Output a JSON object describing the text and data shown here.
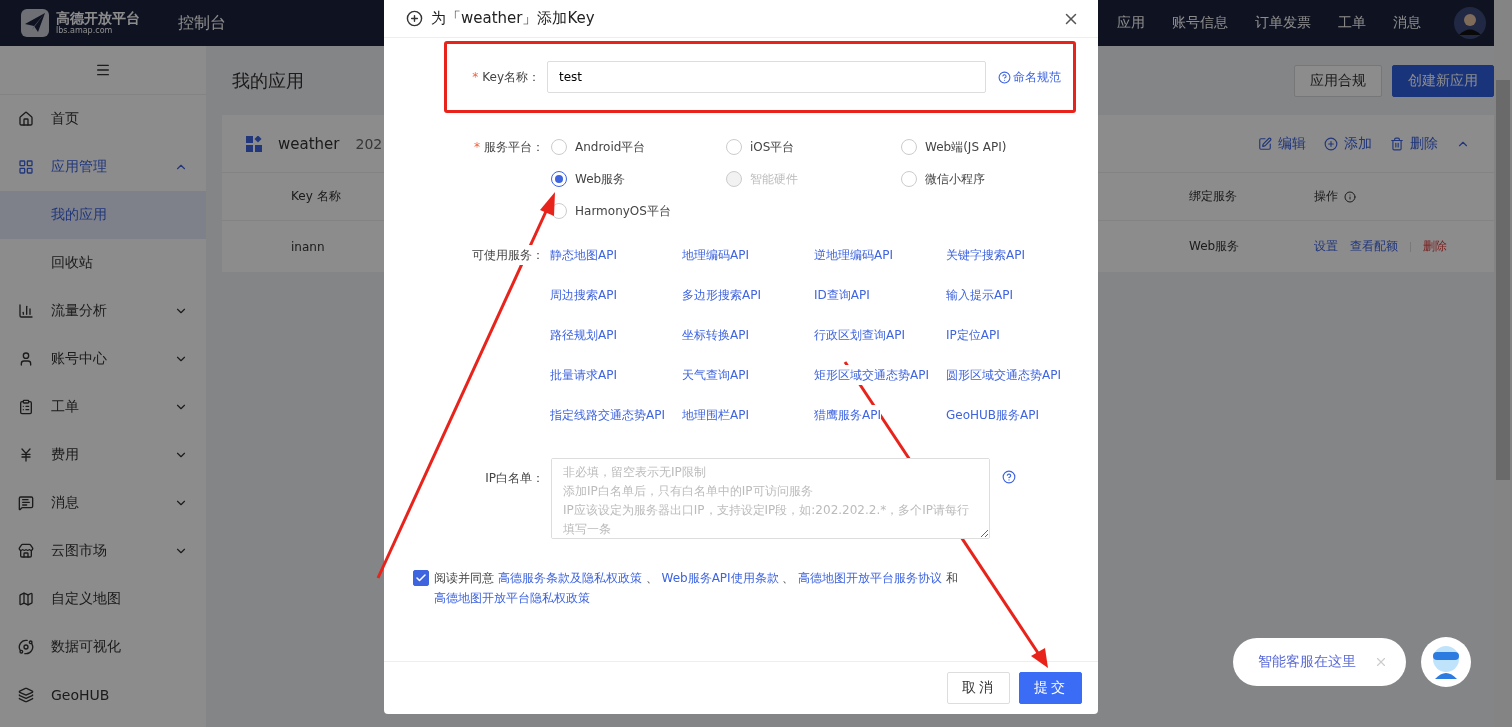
{
  "topbar": {
    "logo_name": "高德开放平台",
    "logo_url": "lbs.amap.com",
    "console": "控制台",
    "nav": [
      "应用",
      "账号信息",
      "订单发票",
      "工单",
      "消息"
    ]
  },
  "sidebar": {
    "items": [
      {
        "label": "首页",
        "kind": "link",
        "selected": false
      },
      {
        "label": "应用管理",
        "kind": "group",
        "selected": true,
        "expanded": true,
        "children": [
          {
            "label": "我的应用",
            "selected": true
          },
          {
            "label": "回收站",
            "selected": false
          }
        ]
      },
      {
        "label": "流量分析",
        "kind": "group",
        "selected": false,
        "expanded": false
      },
      {
        "label": "账号中心",
        "kind": "group",
        "selected": false,
        "expanded": false
      },
      {
        "label": "工单",
        "kind": "group",
        "selected": false,
        "expanded": false
      },
      {
        "label": "费用",
        "kind": "group",
        "selected": false,
        "expanded": false
      },
      {
        "label": "消息",
        "kind": "group",
        "selected": false,
        "expanded": false
      },
      {
        "label": "云图市场",
        "kind": "group",
        "selected": false,
        "expanded": false
      },
      {
        "label": "自定义地图",
        "kind": "link",
        "selected": false
      },
      {
        "label": "数据可视化",
        "kind": "link",
        "selected": false
      },
      {
        "label": "GeoHUB",
        "kind": "link",
        "selected": false
      }
    ]
  },
  "main": {
    "title": "我的应用",
    "buttons": [
      {
        "label": "应用合规",
        "kind": "default"
      },
      {
        "label": "创建新应用",
        "kind": "primary"
      }
    ]
  },
  "app_card": {
    "name": "weather",
    "date": "202",
    "expanded": true,
    "actions": [
      "编辑",
      "添加",
      "删除"
    ],
    "columns": [
      "Key 名称",
      "绑定服务",
      "操作"
    ],
    "rows": [
      {
        "key_name": "inann",
        "service": "Web服务",
        "actions": [
          {
            "label": "设置",
            "kind": "link"
          },
          {
            "label": "查看配额",
            "kind": "link"
          },
          {
            "label": "删除",
            "kind": "danger"
          }
        ]
      }
    ]
  },
  "dialog": {
    "title": "为「weather」添加Key",
    "key_name": {
      "mark": "*",
      "label": "Key名称：",
      "value": "test",
      "help": "命名规范",
      "highlighted": true
    },
    "platform": {
      "mark": "*",
      "label": "服务平台：",
      "options": [
        {
          "label": "Android平台",
          "selected": false,
          "disabled": false
        },
        {
          "label": "iOS平台",
          "selected": false,
          "disabled": false
        },
        {
          "label": "Web端(JS API)",
          "selected": false,
          "disabled": false
        },
        {
          "label": "Web服务",
          "selected": true,
          "disabled": false
        },
        {
          "label": "智能硬件",
          "selected": false,
          "disabled": true
        },
        {
          "label": "微信小程序",
          "selected": false,
          "disabled": false
        },
        {
          "label": "HarmonyOS平台",
          "selected": false,
          "disabled": false
        }
      ]
    },
    "services": {
      "label": "可使用服务：",
      "items": [
        "静态地图API",
        "地理编码API",
        "逆地理编码API",
        "关键字搜索API",
        "周边搜索API",
        "多边形搜索API",
        "ID查询API",
        "输入提示API",
        "路径规划API",
        "坐标转换API",
        "行政区划查询API",
        "IP定位API",
        "批量请求API",
        "天气查询API",
        "矩形区域交通态势API",
        "圆形区域交通态势API",
        "指定线路交通态势API",
        "地理围栏API",
        "猎鹰服务API",
        "GeoHUB服务API"
      ]
    },
    "ip_whitelist": {
      "label": "IP白名单：",
      "placeholder": [
        "非必填，留空表示无IP限制",
        "添加IP白名单后，只有白名单中的IP可访问服务",
        "IP应该设定为服务器出口IP，支持设定IP段，如:202.202.2.*，多个IP请每行填写一条"
      ]
    },
    "agreement": {
      "checked": true,
      "prefix": "阅读并同意",
      "links": [
        "高德服务条款及隐私权政策",
        "Web服务API使用条款",
        "高德地图开放平台服务协议",
        "高德地图开放平台隐私权政策"
      ],
      "separators": [
        "、",
        "、",
        "和"
      ]
    },
    "buttons": [
      {
        "label": "取消",
        "kind": "default"
      },
      {
        "label": "提交",
        "kind": "primary"
      }
    ]
  },
  "chat_widget": {
    "message": "智能客服在这里"
  }
}
